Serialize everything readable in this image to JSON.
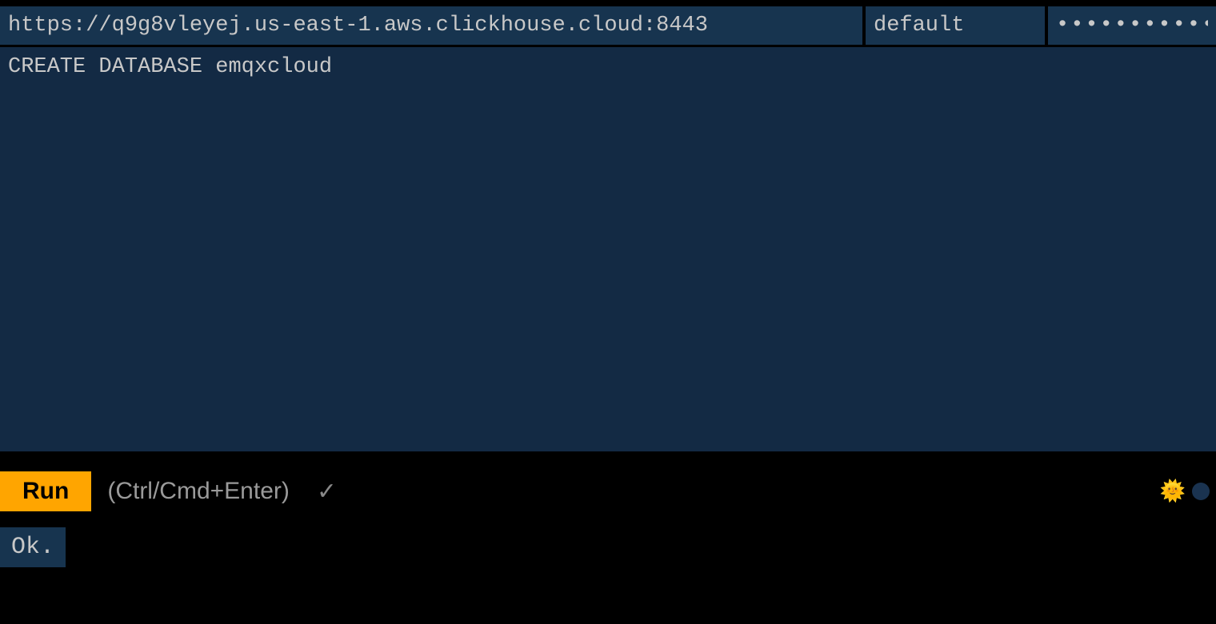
{
  "connection": {
    "url": "https://q9g8vleyej.us-east-1.aws.clickhouse.cloud:8443",
    "username": "default",
    "password": "••••••••••••••"
  },
  "editor": {
    "query": "CREATE DATABASE emqxcloud"
  },
  "actions": {
    "run_label": "Run",
    "shortcut_hint": "(Ctrl/Cmd+Enter)"
  },
  "result": {
    "status": "Ok."
  }
}
